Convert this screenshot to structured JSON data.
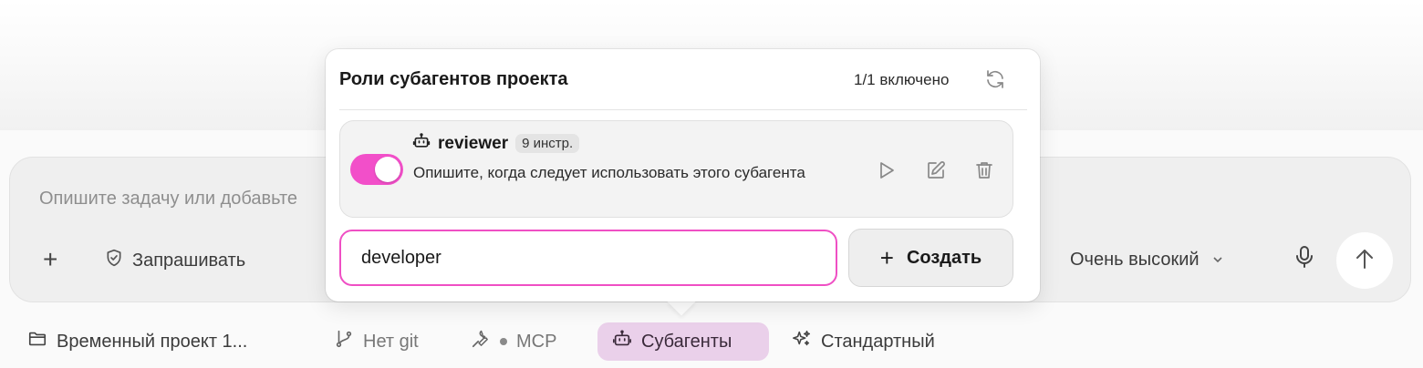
{
  "composer": {
    "placeholder": "Опишите задачу или добавьте",
    "approval_label": "Запрашивать",
    "effort_label": "Очень высокий"
  },
  "bottom_bar": {
    "project": "Временный проект 1...",
    "git": "Нет git",
    "mcp": "MCP",
    "subagents": "Субагенты",
    "mode": "Стандартный"
  },
  "popover": {
    "title": "Роли субагентов проекта",
    "enabled_count": "1/1 включено",
    "agents": [
      {
        "name": "reviewer",
        "badge": "9 инстр.",
        "description": "Опишите, когда следует использовать этого субагента",
        "enabled": true
      }
    ],
    "new_name_value": "developer",
    "create_label": "Создать"
  },
  "colors": {
    "accent": "#f24fc9",
    "selected_chip": "#ead0ea"
  }
}
